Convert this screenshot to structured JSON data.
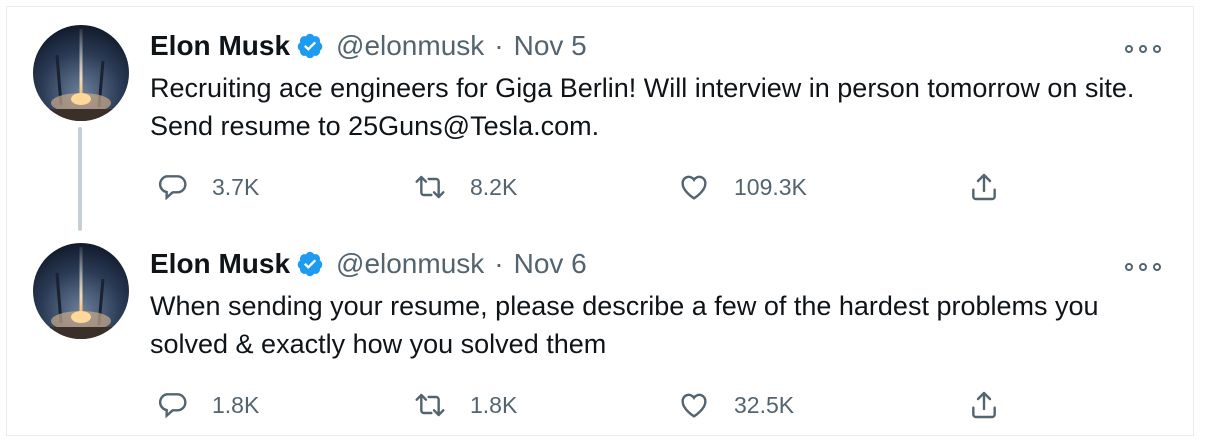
{
  "tweets": [
    {
      "name": "Elon Musk",
      "handle": "@elonmusk",
      "separator": "·",
      "date": "Nov 5",
      "text": "Recruiting ace engineers for Giga Berlin! Will interview in person tomorrow on site. Send resume to 25Guns@Tesla.com.",
      "replies": "3.7K",
      "retweets": "8.2K",
      "likes": "109.3K"
    },
    {
      "name": "Elon Musk",
      "handle": "@elonmusk",
      "separator": "·",
      "date": "Nov 6",
      "text": "When sending your resume, please describe a few of the hardest problems you solved & exactly how you solved them",
      "replies": "1.8K",
      "retweets": "1.8K",
      "likes": "32.5K"
    }
  ],
  "icons": {
    "verified": "verified-badge-icon",
    "more": "more-options-icon",
    "reply": "reply-icon",
    "retweet": "retweet-icon",
    "like": "heart-icon",
    "share": "share-icon"
  },
  "colors": {
    "verified_blue": "#1d9bf0",
    "text_primary": "#0f1419",
    "text_secondary": "#536471",
    "thread_line": "#c4cfd6",
    "border": "#e6ecf0"
  }
}
